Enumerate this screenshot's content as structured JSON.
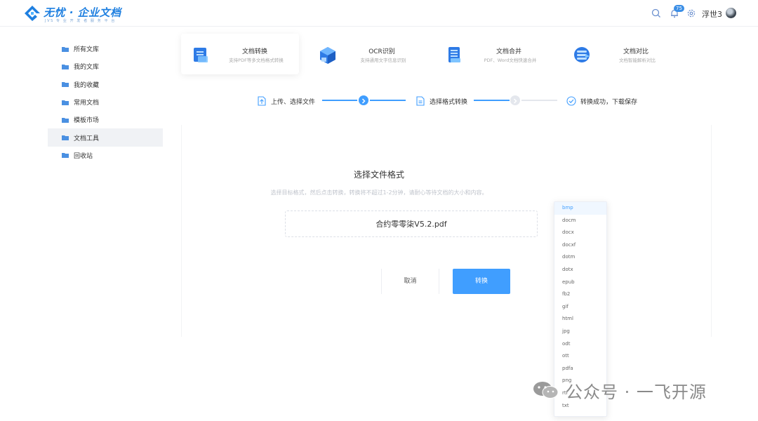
{
  "header": {
    "logo_title": "无忧 · 企业文档",
    "logo_subtitle": "JVS 专 业 开 发 者 服 务 平 台",
    "notification_count": "75",
    "username": "浮世3"
  },
  "sidebar": {
    "items": [
      {
        "label": "所有文库",
        "icon": "folder-icon"
      },
      {
        "label": "我的文库",
        "icon": "folder-icon"
      },
      {
        "label": "我的收藏",
        "icon": "folder-icon"
      },
      {
        "label": "常用文档",
        "icon": "folder-icon"
      },
      {
        "label": "模板市场",
        "icon": "folder-icon"
      },
      {
        "label": "文档工具",
        "icon": "folder-icon",
        "active": true
      },
      {
        "label": "回收站",
        "icon": "folder-icon"
      }
    ]
  },
  "tools": [
    {
      "title": "文档转换",
      "desc": "支持PDF等多文档格式转换",
      "icon": "document-convert-icon",
      "active": true
    },
    {
      "title": "OCR识别",
      "desc": "支持通用文字信息识别",
      "icon": "ocr-cube-icon"
    },
    {
      "title": "文档合并",
      "desc": "PDF、Word文档快速合并",
      "icon": "document-merge-icon"
    },
    {
      "title": "文档对比",
      "desc": "文档智能解析对比",
      "icon": "document-compare-icon"
    }
  ],
  "steps": [
    {
      "label": "上传、选择文件",
      "icon": "upload-file-icon"
    },
    {
      "label": "选择格式转换",
      "icon": "format-file-icon"
    },
    {
      "label": "转换成功，下载保存",
      "icon": "check-circle-icon"
    }
  ],
  "main": {
    "title": "选择文件格式",
    "hint": "选择目标格式，然后点击转换，转换将不超过1-2分钟，请耐心等待文档的大小和内容。",
    "file_name": "合约零零柒V5.2.pdf",
    "cancel_label": "取消",
    "convert_label": "转换"
  },
  "format_dropdown": {
    "selected": "bmp",
    "options": [
      "bmp",
      "docm",
      "docx",
      "docxf",
      "dotm",
      "dotx",
      "epub",
      "fb2",
      "gif",
      "html",
      "jpg",
      "odt",
      "ott",
      "pdfa",
      "png",
      "rtf",
      "txt"
    ]
  },
  "watermark": {
    "text": "公众号 · 一飞开源"
  },
  "colors": {
    "accent": "#409eff",
    "brand": "#1e7fe0",
    "step_inactive": "#d9dde3"
  }
}
